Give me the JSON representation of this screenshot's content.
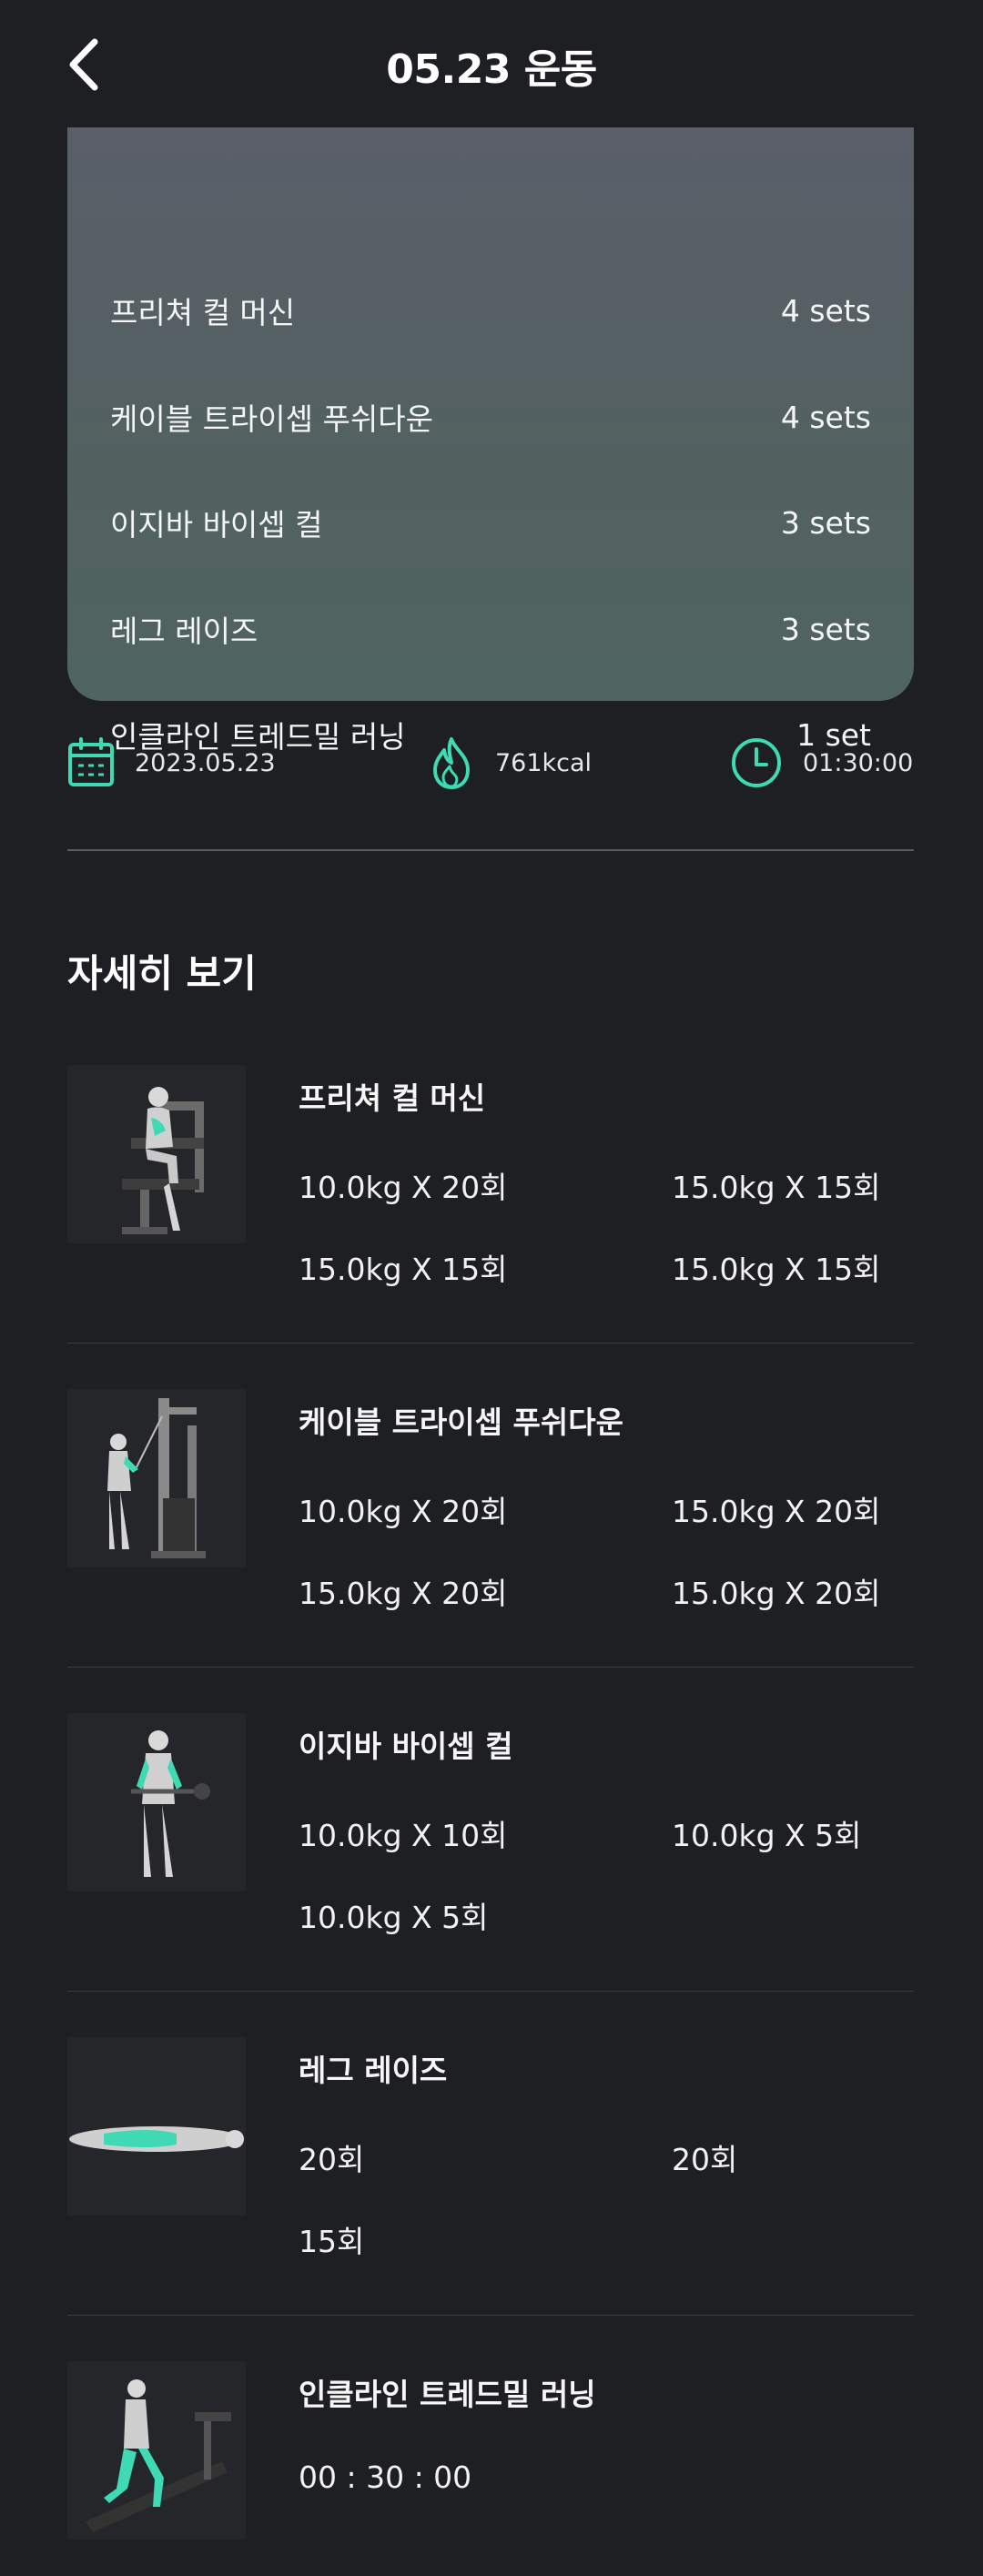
{
  "header": {
    "title": "05.23 운동"
  },
  "summary": [
    {
      "name": "프리쳐 컬 머신",
      "sets": "4 sets"
    },
    {
      "name": "케이블 트라이셉 푸쉬다운",
      "sets": "4 sets"
    },
    {
      "name": "이지바 바이셉 컬",
      "sets": "3 sets"
    },
    {
      "name": "레그 레이즈",
      "sets": "3 sets"
    },
    {
      "name": "인클라인 트레드밀 러닝",
      "sets": "1 set"
    }
  ],
  "stats": {
    "date": "2023.05.23",
    "calories": "761kcal",
    "duration": "01:30:00"
  },
  "colors": {
    "accent": "#3fd9b4",
    "background": "#1e1f23"
  },
  "details_title": "자세히 보기",
  "exercises": [
    {
      "name": "프리쳐 컬 머신",
      "sets": [
        "10.0kg X 20회",
        "15.0kg X 15회",
        "15.0kg X 15회",
        "15.0kg X 15회"
      ]
    },
    {
      "name": "케이블 트라이셉 푸쉬다운",
      "sets": [
        "10.0kg X 20회",
        "15.0kg X 20회",
        "15.0kg X 20회",
        "15.0kg X 20회"
      ]
    },
    {
      "name": "이지바 바이셉 컬",
      "sets": [
        "10.0kg X 10회",
        "10.0kg X 5회",
        "10.0kg X 5회"
      ]
    },
    {
      "name": "레그 레이즈",
      "sets": [
        "20회",
        "20회",
        "15회"
      ]
    },
    {
      "name": "인클라인 트레드밀 러닝",
      "sets": [
        "00 : 30 : 00"
      ]
    }
  ]
}
